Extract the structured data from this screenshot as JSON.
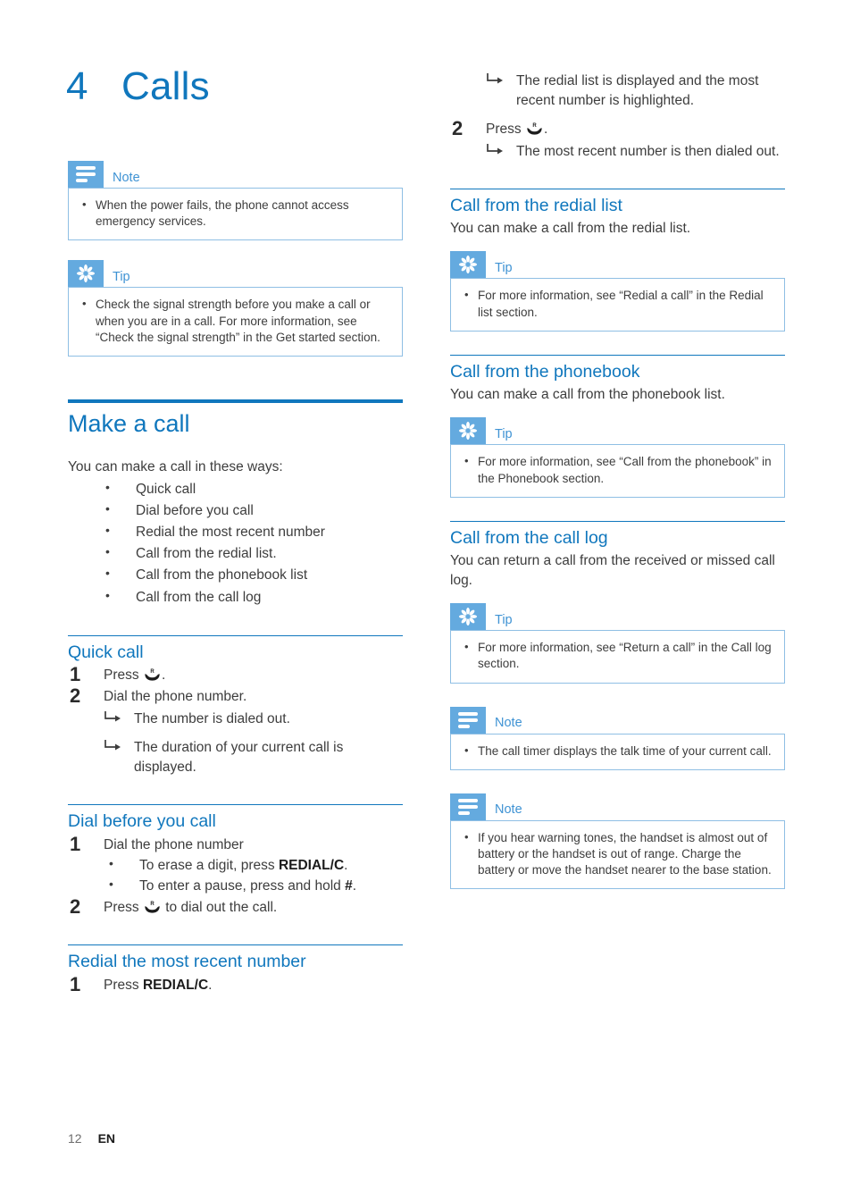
{
  "chapter": {
    "number": "4",
    "title": "Calls"
  },
  "icons": {
    "note": "note-lines-icon",
    "tip": "asterisk-starburst-icon",
    "handset": "talk-handset-icon",
    "result_arrow": "hooked-right-arrow-icon"
  },
  "colors": {
    "accent": "#1077bd",
    "badge": "#64aadf",
    "callout_border": "#8fbfe4",
    "label": "#3f93d4",
    "body_text": "#3d3d3d"
  },
  "left_column": {
    "note_power": {
      "label": "Note",
      "items": [
        "When the power fails, the phone cannot access emergency services."
      ]
    },
    "tip_signal": {
      "label": "Tip",
      "items": [
        "Check the signal strength before you make a call or when you are in a call. For more information, see “Check the signal strength” in the Get started section."
      ]
    },
    "make_a_call": {
      "heading": "Make a call",
      "intro": "You can make a call in these ways:",
      "ways": [
        "Quick call",
        "Dial before you call",
        "Redial the most recent number",
        "Call from the redial list.",
        "Call from the phonebook list",
        "Call from the call log"
      ]
    },
    "quick_call": {
      "heading": "Quick call",
      "step1_num": "1",
      "step1_text_pre": "Press",
      "step1_text_post": ".",
      "step2_num": "2",
      "step2_text": "Dial the phone number.",
      "step2_results": [
        "The number is dialed out.",
        "The duration of your current call is displayed."
      ]
    },
    "dial_before": {
      "heading": "Dial before you call",
      "step1_num": "1",
      "step1_text": "Dial the phone number",
      "step1_bullets": [
        {
          "pre": "To erase a digit, press ",
          "bold": "REDIAL/C",
          "post": "."
        },
        {
          "pre": "To enter a pause, press and hold ",
          "bold": "#",
          "post": "."
        }
      ],
      "step2_num": "2",
      "step2_text_pre": "Press",
      "step2_text_post": "to dial out the call."
    },
    "redial_recent": {
      "heading": "Redial the most recent number",
      "step1_num": "1",
      "step1_text_pre": "Press ",
      "step1_bold": "REDIAL/C",
      "step1_text_post": "."
    }
  },
  "right_column": {
    "redial_continued": {
      "result_top": "The redial list is displayed and the most recent number is highlighted.",
      "step2_num": "2",
      "step2_text_pre": "Press",
      "step2_text_post": ".",
      "step2_result": "The most recent number is then dialed out."
    },
    "call_redial_list": {
      "heading": "Call from the redial list",
      "para": "You can make a call from the redial list.",
      "tip_label": "Tip",
      "tip_items": [
        "For more information, see “Redial a call” in the Redial list section."
      ]
    },
    "call_phonebook": {
      "heading": "Call from the phonebook",
      "para": "You can make a call from the phonebook list.",
      "tip_label": "Tip",
      "tip_items": [
        "For more information, see “Call from the phonebook” in the Phonebook section."
      ]
    },
    "call_log": {
      "heading": "Call from the call log",
      "para": "You can return a call from the received or missed call log.",
      "tip_label": "Tip",
      "tip_items": [
        "For more information, see “Return a call” in the Call log section."
      ],
      "note1_label": "Note",
      "note1_items": [
        "The call timer displays the talk time of your current call."
      ],
      "note2_label": "Note",
      "note2_items": [
        "If you hear warning tones, the handset is almost out of battery or the handset is out of range. Charge the battery or move the handset nearer to the base station."
      ]
    }
  },
  "footer": {
    "page_number": "12",
    "language": "EN"
  }
}
